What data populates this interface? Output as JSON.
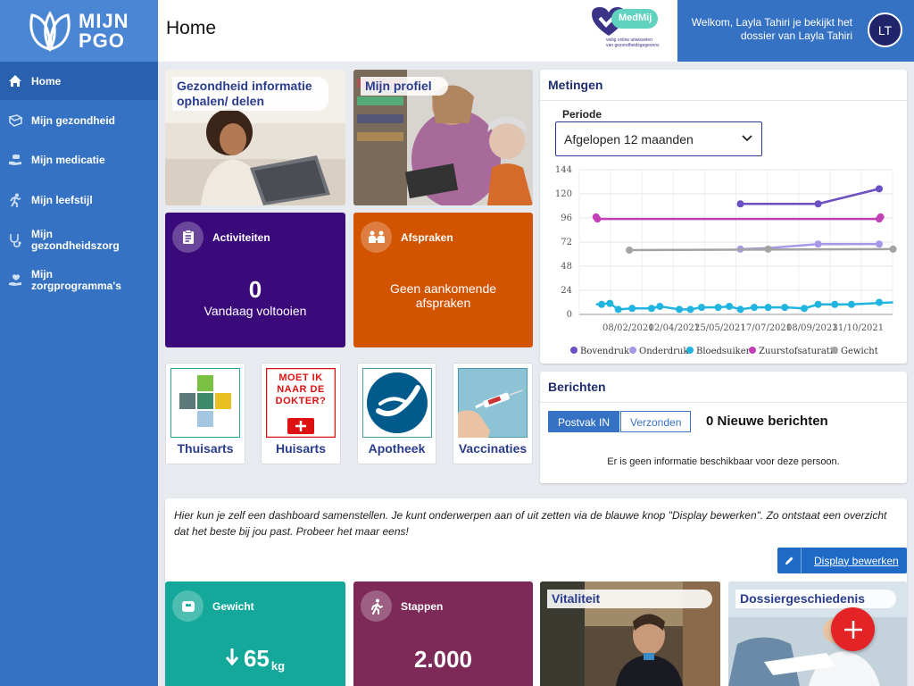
{
  "app": {
    "logo_line1": "MIJN",
    "logo_line2": "PGO",
    "page_title": "Home"
  },
  "medmij": {
    "brand": "MedMij",
    "tagline1": "veilig online uitwisselen",
    "tagline2": "van gezondheidsgegevens"
  },
  "user": {
    "welcome": "Welkom, Layla Tahiri je bekijkt het dossier van Layla Tahiri",
    "initials": "LT"
  },
  "sidebar": {
    "items": [
      {
        "label": "Home",
        "icon": "home-icon"
      },
      {
        "label": "Mijn gezondheid",
        "icon": "book-icon"
      },
      {
        "label": "Mijn medicatie",
        "icon": "medication-icon"
      },
      {
        "label": "Mijn leefstijl",
        "icon": "running-icon"
      },
      {
        "label": "Mijn gezondheidszorg",
        "icon": "stethoscope-icon"
      },
      {
        "label": "Mijn zorgprogramma's",
        "icon": "care-icon"
      }
    ]
  },
  "tiles": {
    "health_info": "Gezondheid informatie ophalen/ delen",
    "profile": "Mijn profiel",
    "activities": {
      "title": "Activiteiten",
      "count": "0",
      "sub": "Vandaag voltooien"
    },
    "appointments": {
      "title": "Afspraken",
      "text": "Geen aankomende afspraken"
    },
    "small": [
      {
        "label": "Thuisarts"
      },
      {
        "label": "Huisarts",
        "sign": [
          "MOET IK",
          "NAAR DE",
          "DOKTER?"
        ]
      },
      {
        "label": "Apotheek"
      },
      {
        "label": "Vaccinaties"
      }
    ]
  },
  "metingen": {
    "title": "Metingen",
    "period_label": "Periode",
    "period_value": "Afgelopen 12 maanden"
  },
  "chart_data": {
    "type": "line",
    "x": [
      "08/02/2021",
      "02/04/2021",
      "25/05/2021",
      "17/07/2021",
      "08/09/2021",
      "31/10/2021"
    ],
    "ylim": [
      0,
      144
    ],
    "yticks": [
      0,
      24,
      48,
      72,
      96,
      120,
      144
    ],
    "grid": true,
    "legend_position": "bottom",
    "series": [
      {
        "name": "Bovendruk",
        "color": "#6b4fc4",
        "points": [
          [
            0.5,
            110
          ],
          [
            0.78,
            110
          ],
          [
            1.0,
            125
          ]
        ],
        "line": [
          [
            0.5,
            110
          ],
          [
            0.78,
            110
          ],
          [
            1.0,
            125
          ]
        ]
      },
      {
        "name": "Onderdruk",
        "color": "#a897e6",
        "points": [
          [
            0.5,
            65
          ],
          [
            0.78,
            70
          ],
          [
            1.0,
            70
          ]
        ],
        "line": [
          [
            0.5,
            65
          ],
          [
            0.6,
            66
          ],
          [
            0.78,
            70
          ],
          [
            1.0,
            70
          ]
        ]
      },
      {
        "name": "Bloedsuiker",
        "color": "#20b4e0",
        "points": [
          [
            0.0,
            10
          ],
          [
            0.03,
            11
          ],
          [
            0.06,
            5
          ],
          [
            0.11,
            6
          ],
          [
            0.18,
            6
          ],
          [
            0.21,
            8
          ],
          [
            0.28,
            5
          ],
          [
            0.32,
            5
          ],
          [
            0.36,
            7
          ],
          [
            0.42,
            7
          ],
          [
            0.46,
            8
          ],
          [
            0.5,
            5
          ],
          [
            0.55,
            7
          ],
          [
            0.6,
            7
          ],
          [
            0.66,
            7
          ],
          [
            0.73,
            6
          ],
          [
            0.78,
            10
          ],
          [
            0.84,
            10
          ],
          [
            0.9,
            10
          ],
          [
            1.0,
            12
          ]
        ],
        "line": [
          [
            -0.02,
            10
          ],
          [
            0.03,
            11
          ],
          [
            0.06,
            5
          ],
          [
            0.11,
            6
          ],
          [
            0.18,
            6
          ],
          [
            0.21,
            8
          ],
          [
            0.28,
            5
          ],
          [
            0.32,
            5
          ],
          [
            0.36,
            7
          ],
          [
            0.42,
            7
          ],
          [
            0.46,
            8
          ],
          [
            0.5,
            5
          ],
          [
            0.55,
            7
          ],
          [
            0.6,
            7
          ],
          [
            0.66,
            7
          ],
          [
            0.73,
            6
          ],
          [
            0.78,
            10
          ],
          [
            0.84,
            10
          ],
          [
            0.9,
            10
          ],
          [
            1.05,
            12
          ]
        ]
      },
      {
        "name": "Zuurstofsaturatie",
        "color": "#c23fb5",
        "points": [
          [
            -0.02,
            97
          ],
          [
            -0.015,
            95
          ],
          [
            1.0,
            95
          ],
          [
            1.005,
            97
          ]
        ],
        "line": [
          [
            -0.02,
            95
          ],
          [
            1.0,
            95
          ]
        ]
      },
      {
        "name": "Gewicht",
        "color": "#a3a3a3",
        "points": [
          [
            0.1,
            64
          ],
          [
            0.6,
            65
          ],
          [
            1.05,
            65
          ]
        ],
        "line": [
          [
            0.1,
            64
          ],
          [
            1.05,
            65
          ]
        ]
      }
    ]
  },
  "berichten": {
    "title": "Berichten",
    "tab_in": "Postvak IN",
    "tab_out": "Verzonden",
    "count_text": "0 Nieuwe berichten",
    "empty_text": "Er is geen informatie beschikbaar voor deze persoon."
  },
  "dashboard": {
    "intro": "Hier kun je zelf een dashboard samenstellen. Je kunt onderwerpen aan of uit zetten via de blauwe knop \"Display bewerken\". Zo ontstaat een overzicht dat het beste bij jou past. Probeer het maar eens!",
    "edit_button": "Display bewerken"
  },
  "widgets": {
    "weight": {
      "title": "Gewicht",
      "value": "65",
      "unit": "kg"
    },
    "steps": {
      "title": "Stappen",
      "value": "2.000"
    },
    "vitality": "Vitaliteit",
    "history": "Dossiergeschiedenis"
  },
  "colors": {
    "sidebar": "#3572c3",
    "activities": "#3a0a7a",
    "appointments": "#d25300",
    "weight": "#13a89a",
    "steps": "#7d2a58",
    "fab": "#e32325"
  }
}
